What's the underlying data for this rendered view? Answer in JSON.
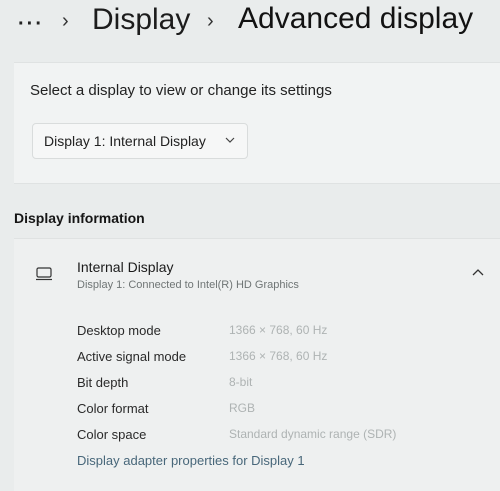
{
  "breadcrumb": {
    "more": "···",
    "items": [
      "Display",
      "Advanced display"
    ],
    "separator": "›"
  },
  "select_display": {
    "prompt": "Select a display to view or change its settings",
    "selected": "Display 1: Internal Display",
    "chevron_icon": "chevron-down-icon"
  },
  "display_information": {
    "section_title": "Display information",
    "device_icon": "monitor-icon",
    "name": "Internal Display",
    "subtitle": "Display 1: Connected to Intel(R) HD Graphics",
    "expanded": true,
    "properties": [
      {
        "label": "Desktop mode",
        "value": "1366 × 768, 60 Hz"
      },
      {
        "label": "Active signal mode",
        "value": "1366 × 768, 60 Hz"
      },
      {
        "label": "Bit depth",
        "value": "8-bit"
      },
      {
        "label": "Color format",
        "value": "RGB"
      },
      {
        "label": "Color space",
        "value": "Standard dynamic range (SDR)"
      }
    ],
    "adapter_link": "Display adapter properties for Display 1"
  },
  "colors": {
    "background": "#e9ecec",
    "card": "#f1f3f3",
    "muted_text": "#aeb3b3",
    "link": "#48677a"
  }
}
